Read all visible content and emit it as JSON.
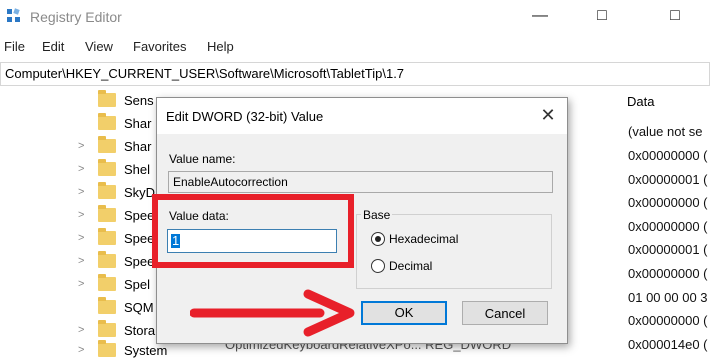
{
  "window": {
    "title": "Registry Editor"
  },
  "menu": [
    "File",
    "Edit",
    "View",
    "Favorites",
    "Help"
  ],
  "address": "Computer\\HKEY_CURRENT_USER\\Software\\Microsoft\\TabletTip\\1.7",
  "tree": {
    "items": [
      {
        "label": "Sens",
        "chevron": ""
      },
      {
        "label": "Shar",
        "chevron": ""
      },
      {
        "label": "Shar",
        "chevron": ">"
      },
      {
        "label": "Shel",
        "chevron": ">"
      },
      {
        "label": "SkyD",
        "chevron": ">"
      },
      {
        "label": "Spee",
        "chevron": ">"
      },
      {
        "label": "Spee",
        "chevron": ">"
      },
      {
        "label": "Spee",
        "chevron": ">"
      },
      {
        "label": "Spel",
        "chevron": ">"
      },
      {
        "label": "SQM",
        "chevron": ""
      },
      {
        "label": "Stora",
        "chevron": ">"
      },
      {
        "label": "System",
        "chevron": ">"
      }
    ]
  },
  "values_pane": {
    "data_header": "Data",
    "data": [
      "(value not se",
      "0x00000000 (",
      "0x00000001 (",
      "0x00000000 (",
      "0x00000000 (",
      "0x00000001 (",
      "0x00000000 (",
      "01 00 00 00 3",
      "0x00000000 (",
      "0x000014e0 ("
    ],
    "partial_row": "OptimizedKeyboardRelativeXPo...   REG_DWORD"
  },
  "dialog": {
    "title": "Edit DWORD (32-bit) Value",
    "value_name_label": "Value name:",
    "value_name": "EnableAutocorrection",
    "value_data_label": "Value data:",
    "value_data": "1",
    "base_label": "Base",
    "radio_hex": "Hexadecimal",
    "radio_dec": "Decimal",
    "ok_label": "OK",
    "cancel_label": "Cancel"
  },
  "colors": {
    "highlight": "#e8202a",
    "accent": "#0078d7"
  }
}
